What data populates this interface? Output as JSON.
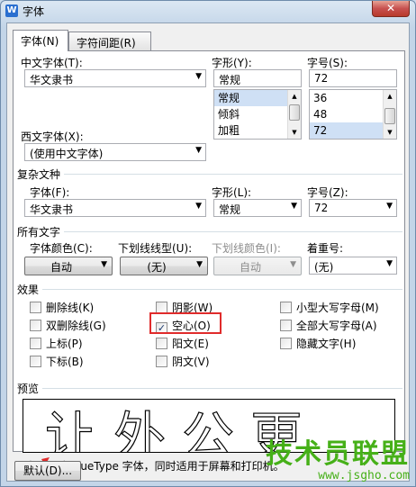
{
  "window": {
    "title": "字体",
    "app_icon_letter": "W",
    "close_glyph": "✕"
  },
  "tabs": [
    {
      "label": "字体(N)"
    },
    {
      "label": "字符间距(R)"
    }
  ],
  "chinese_font": {
    "label": "中文字体(T):",
    "value": "华文隶书"
  },
  "western_font": {
    "label": "西文字体(X):",
    "value": "(使用中文字体)"
  },
  "font_style": {
    "label": "字形(Y):",
    "value": "常规",
    "options": [
      "常规",
      "倾斜",
      "加粗"
    ]
  },
  "font_size": {
    "label": "字号(S):",
    "value": "72",
    "options": [
      "36",
      "48",
      "72"
    ]
  },
  "complex": {
    "title": "复杂文种",
    "font_label": "字体(F):",
    "font_value": "华文隶书",
    "style_label": "字形(L):",
    "style_value": "常规",
    "size_label": "字号(Z):",
    "size_value": "72"
  },
  "all_text": {
    "title": "所有文字",
    "color_label": "字体颜色(C):",
    "color_value": "自动",
    "underline_label": "下划线线型(U):",
    "underline_value": "(无)",
    "underline_color_label": "下划线颜色(I):",
    "underline_color_value": "自动",
    "emphasis_label": "着重号:",
    "emphasis_value": "(无)"
  },
  "effects": {
    "title": "效果",
    "items": [
      {
        "label": "删除线(K)",
        "checked": ""
      },
      {
        "label": "双删除线(G)",
        "checked": ""
      },
      {
        "label": "上标(P)",
        "checked": ""
      },
      {
        "label": "下标(B)",
        "checked": ""
      },
      {
        "label": "阴影(W)",
        "checked": ""
      },
      {
        "label": "空心(O)",
        "checked": "✓"
      },
      {
        "label": "阳文(E)",
        "checked": ""
      },
      {
        "label": "阴文(V)",
        "checked": ""
      },
      {
        "label": "小型大写字母(M)",
        "checked": ""
      },
      {
        "label": "全部大写字母(A)",
        "checked": ""
      },
      {
        "label": "隐藏文字(H)",
        "checked": ""
      }
    ]
  },
  "preview": {
    "title": "预览",
    "sample": "让外公更",
    "note": "这是一种 TrueType 字体，同时适用于屏幕和打印机。"
  },
  "footer": {
    "default_button": "默认(D)..."
  },
  "watermark": {
    "logo": "技术员联盟",
    "url": "www.jsgho.com"
  },
  "colors": {
    "highlight": "#e02b2b",
    "watermark": "#46b018"
  }
}
